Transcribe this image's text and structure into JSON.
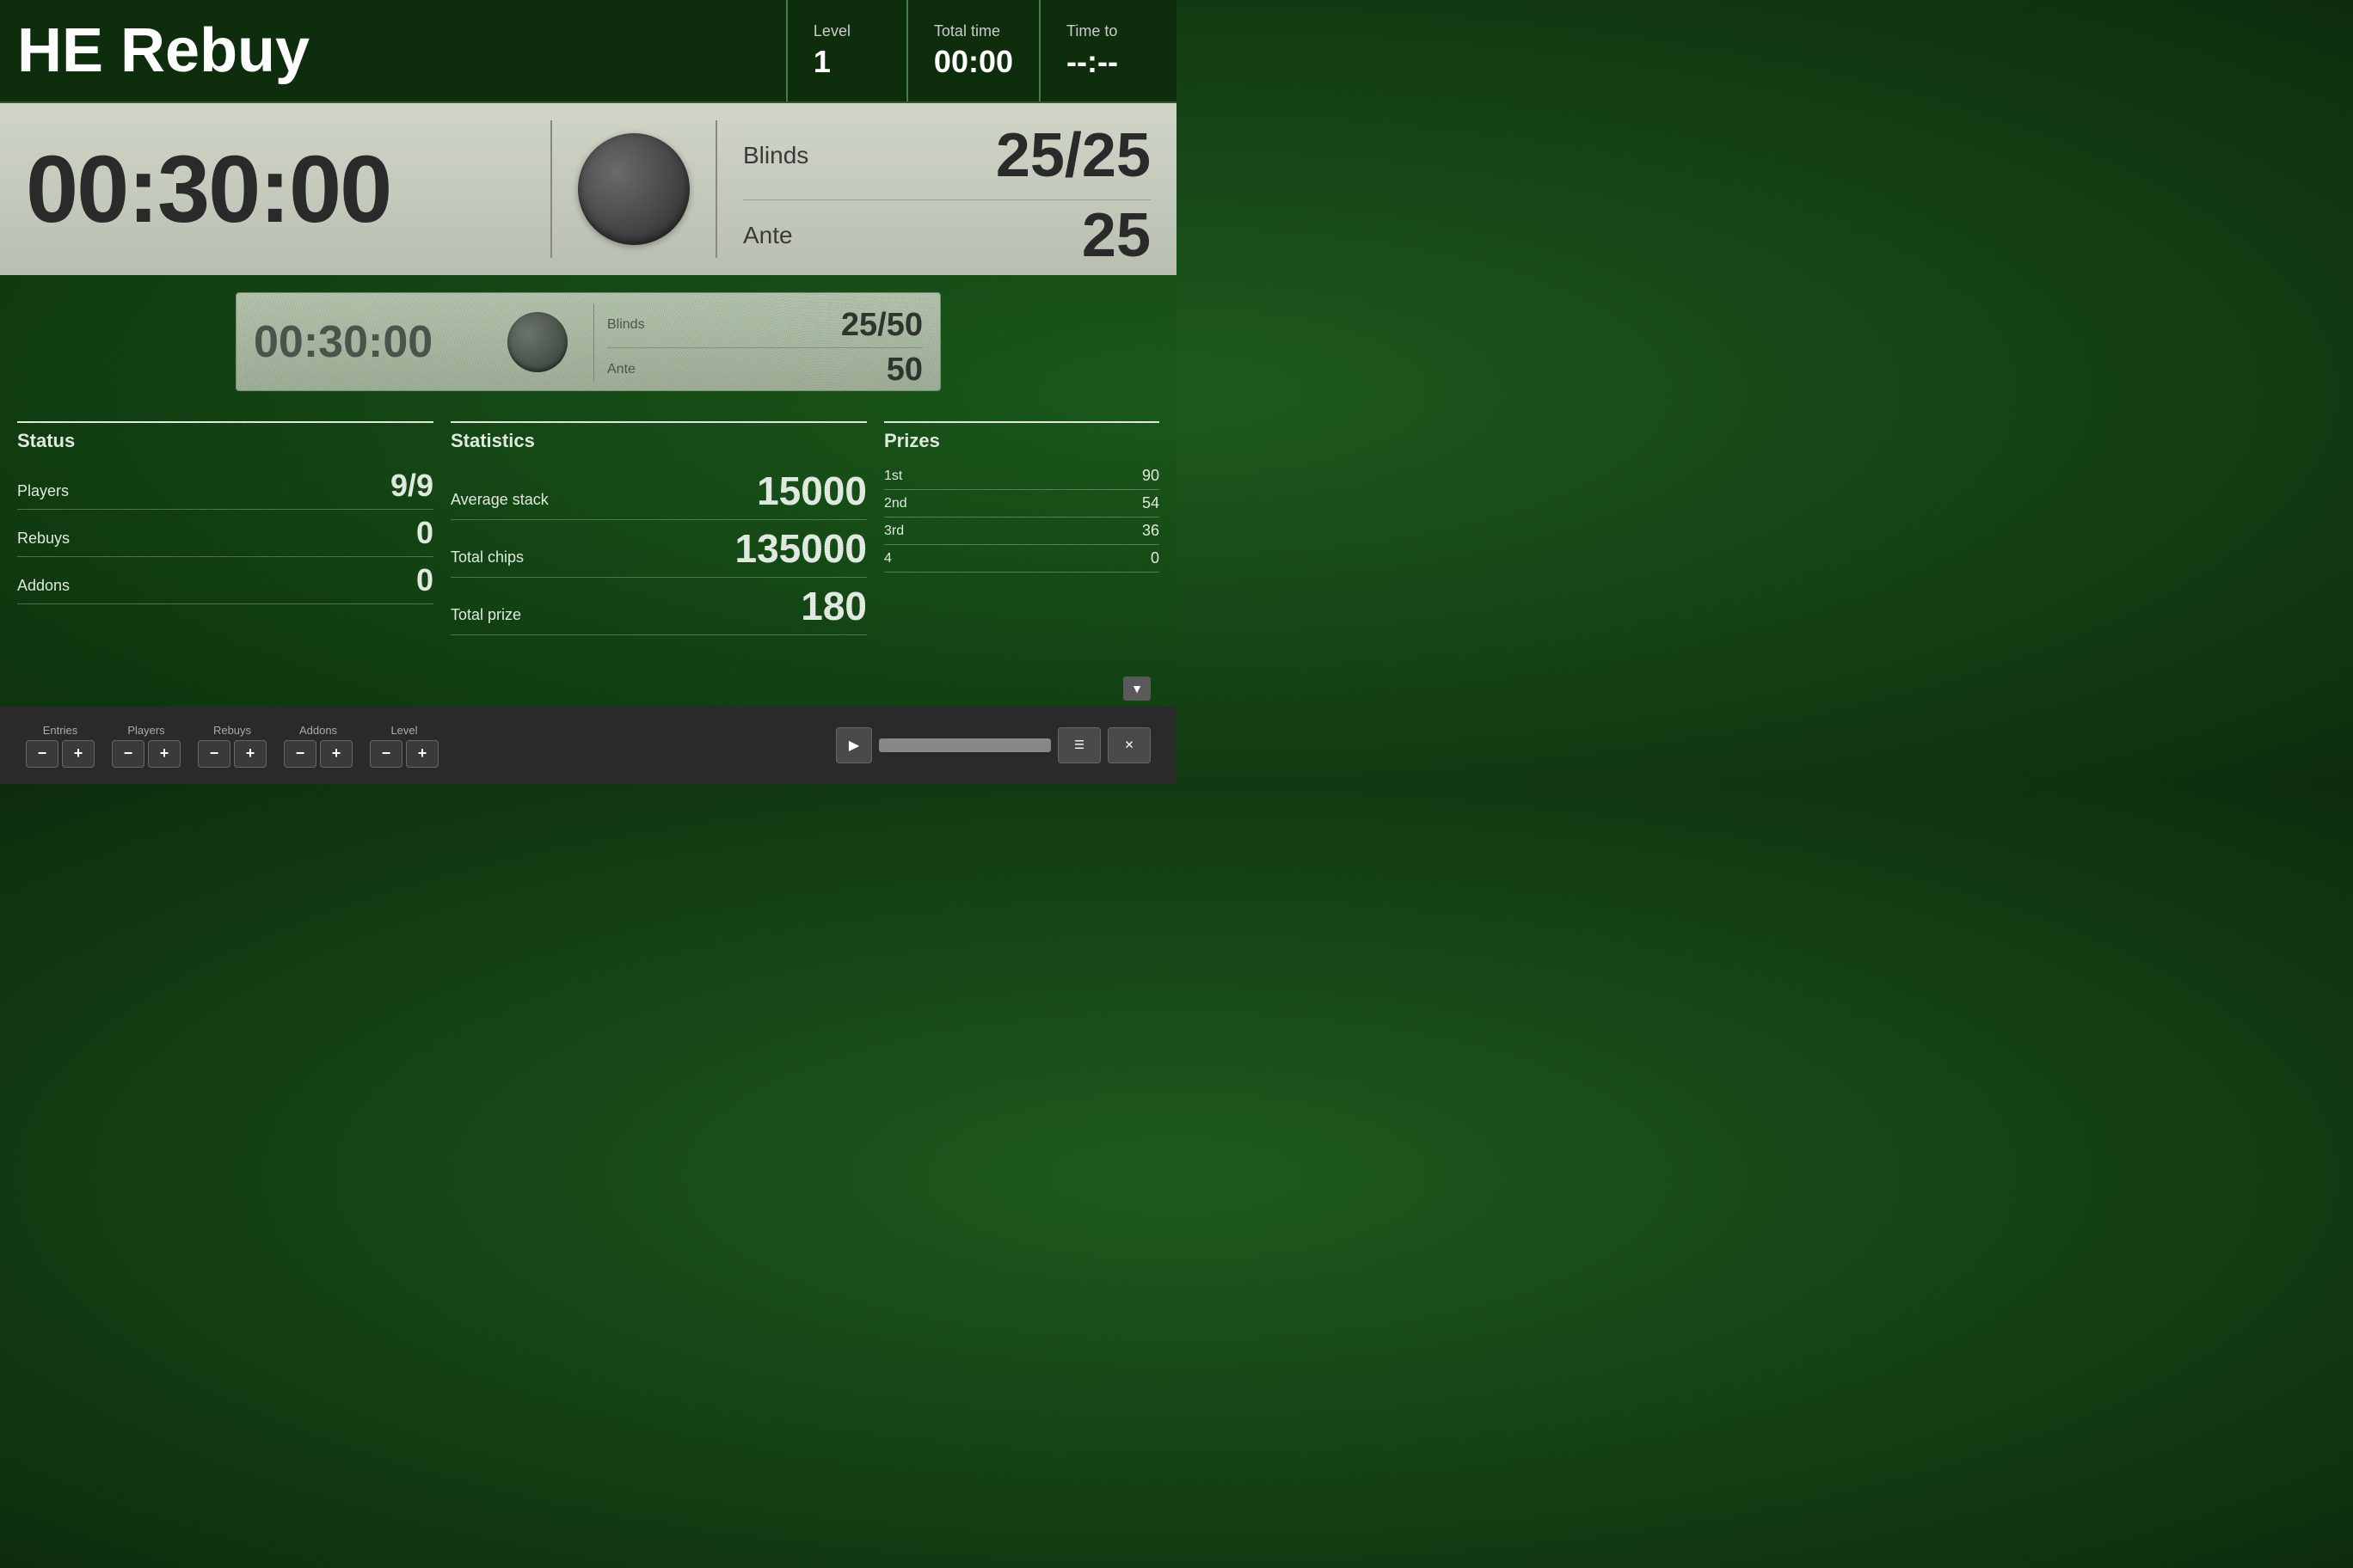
{
  "header": {
    "title": "HE Rebuy",
    "level_label": "Level",
    "level_value": "1",
    "total_time_label": "Total time",
    "total_time_value": "00:00",
    "time_to_label": "Time to",
    "time_to_value": "--:--"
  },
  "main_timer": {
    "display": "00:30:00",
    "blinds_label": "Blinds",
    "blinds_value": "25/25",
    "ante_label": "Ante",
    "ante_value": "25"
  },
  "next_level": {
    "display": "00:30:00",
    "blinds_label": "Blinds",
    "blinds_value": "25/50",
    "ante_label": "Ante",
    "ante_value": "50"
  },
  "status": {
    "title": "Status",
    "players_label": "Players",
    "players_value": "9/9",
    "rebuys_label": "Rebuys",
    "rebuys_value": "0",
    "addons_label": "Addons",
    "addons_value": "0"
  },
  "statistics": {
    "title": "Statistics",
    "avg_stack_label": "Average stack",
    "avg_stack_value": "15000",
    "total_chips_label": "Total chips",
    "total_chips_value": "135000",
    "total_prize_label": "Total prize",
    "total_prize_value": "180"
  },
  "prizes": {
    "title": "Prizes",
    "rows": [
      {
        "place": "1st",
        "value": "90"
      },
      {
        "place": "2nd",
        "value": "54"
      },
      {
        "place": "3rd",
        "value": "36"
      },
      {
        "place": "4",
        "value": "0"
      }
    ]
  },
  "controls": {
    "entries_label": "Entries",
    "players_label": "Players",
    "rebuys_label": "Rebuys",
    "addons_label": "Addons",
    "level_label": "Level",
    "minus_label": "−",
    "plus_label": "+",
    "play_icon": "▶",
    "menu_icon": "☰",
    "close_icon": "✕",
    "scroll_down": "▼"
  }
}
